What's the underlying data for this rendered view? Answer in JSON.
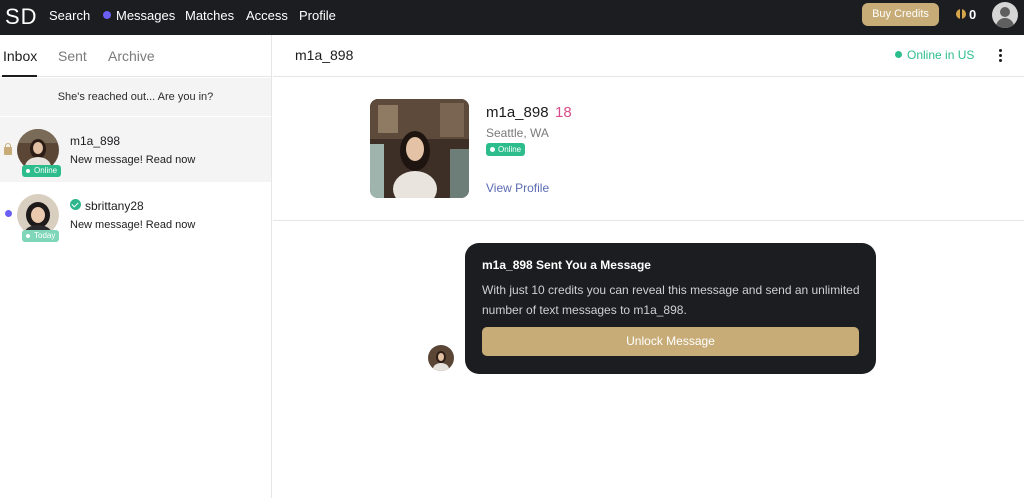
{
  "header": {
    "logo": "SD",
    "nav": [
      {
        "label": "Search"
      },
      {
        "label": "Messages",
        "active": true
      },
      {
        "label": "Matches"
      },
      {
        "label": "Access"
      },
      {
        "label": "Profile"
      }
    ],
    "buy_credits_label": "Buy Credits",
    "credit_count": "0"
  },
  "sidebar": {
    "tabs": [
      "Inbox",
      "Sent",
      "Archive"
    ],
    "active_tab": "Inbox",
    "prompt": "She's reached out... Are you in?",
    "conversations": [
      {
        "name": "m1a_898",
        "snippet": "New message! Read now",
        "status": "Online",
        "locked": true,
        "active": true
      },
      {
        "name": "sbrittany28",
        "snippet": "New message! Read now",
        "status": "Today",
        "verified": true,
        "unread": true
      }
    ]
  },
  "main": {
    "title": "m1a_898",
    "online_status": "Online in US",
    "profile": {
      "name": "m1a_898",
      "age": "18",
      "location": "Seattle, WA",
      "status": "Online",
      "view_profile_label": "View Profile"
    },
    "message_card": {
      "title": "m1a_898 Sent You a Message",
      "body": "With just 10 credits you can reveal this message and send an unlimited number of text messages to m1a_898.",
      "button_label": "Unlock Message"
    }
  },
  "colors": {
    "accent_gold": "#c7ac77",
    "online_green": "#2dbd8c",
    "messages_dot": "#6a5ef5",
    "age_pink": "#d94c8a",
    "dark": "#1b1d21"
  }
}
